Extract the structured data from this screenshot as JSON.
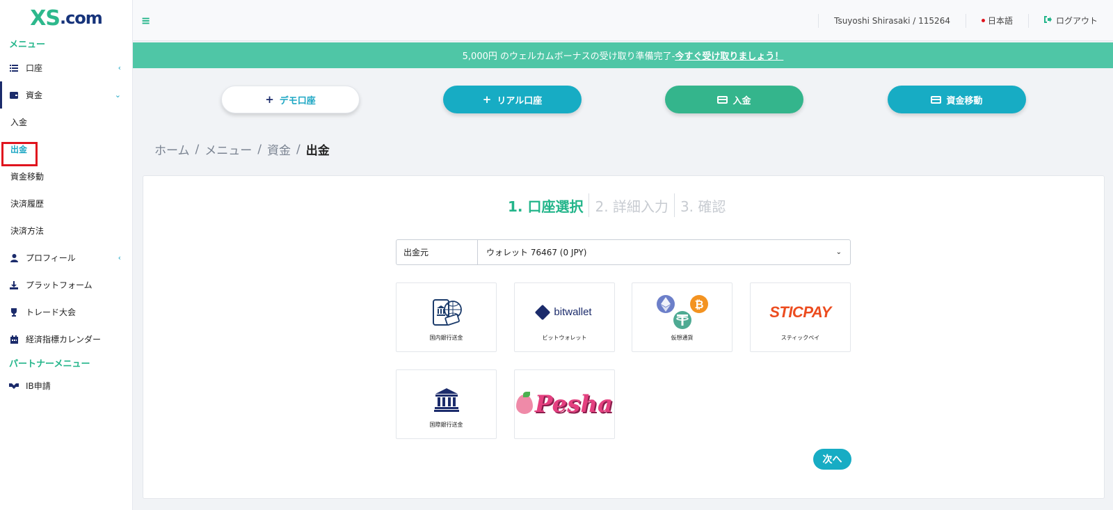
{
  "logo": {
    "xs": "XS",
    "com": ".com"
  },
  "sidebar": {
    "menu_heading": "メニュー",
    "items": [
      {
        "label": "口座",
        "icon": "list-icon"
      },
      {
        "label": "資金",
        "icon": "wallet-icon"
      },
      {
        "label": "入金"
      },
      {
        "label": "出金"
      },
      {
        "label": "資金移動"
      },
      {
        "label": "決済履歴"
      },
      {
        "label": "決済方法"
      },
      {
        "label": "プロフィール",
        "icon": "user-icon"
      },
      {
        "label": "プラットフォーム",
        "icon": "download-icon"
      },
      {
        "label": "トレード大会",
        "icon": "trophy-icon"
      },
      {
        "label": "経済指標カレンダー",
        "icon": "calendar-icon"
      }
    ],
    "partner_heading": "パートナーメニュー",
    "partner_items": [
      {
        "label": "IB申請",
        "icon": "handshake-icon"
      }
    ]
  },
  "topbar": {
    "user": "Tsuyoshi Shirasaki / 115264",
    "language": "日本語",
    "logout": "ログアウト"
  },
  "banner": {
    "text": "5,000円 のウェルカムボーナスの受け取り準備完了- ",
    "link": "今すぐ受け取りましょう！"
  },
  "actions": {
    "demo": "デモ口座",
    "real": "リアル口座",
    "deposit": "入金",
    "transfer": "資金移動"
  },
  "breadcrumb": [
    "ホーム",
    "メニュー",
    "資金",
    "出金"
  ],
  "steps": [
    "1. 口座選択",
    "2. 詳細入力",
    "3. 確認"
  ],
  "source_select": {
    "label": "出金元",
    "value": "ウォレット 76467 (0 JPY)"
  },
  "methods": [
    {
      "caption": "国内銀行送金",
      "icon": "bank-phone-icon"
    },
    {
      "caption": "ビットウォレット",
      "logo_text": "bitwallet"
    },
    {
      "caption": "仮想通貨",
      "icon": "crypto-icon"
    },
    {
      "caption": "スティックペイ",
      "logo_text": "STICPAY"
    },
    {
      "caption": "国際銀行送金",
      "icon": "bank-icon"
    },
    {
      "caption": "",
      "logo_text": "Pesha"
    }
  ],
  "next_button": "次へ",
  "colors": {
    "brand_green": "#23b58a",
    "brand_teal": "#17acc4",
    "navy": "#1b2b6b",
    "banner": "#4fc6a6",
    "highlight": "#e0141e"
  }
}
